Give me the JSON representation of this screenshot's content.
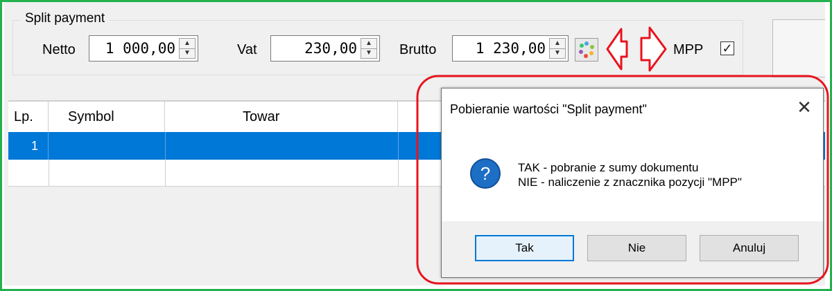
{
  "split_payment": {
    "title": "Split payment",
    "netto_label": "Netto",
    "netto_value": "1 000,00",
    "vat_label": "Vat",
    "vat_value": "230,00",
    "brutto_label": "Brutto",
    "brutto_value": "1 230,00",
    "mpp_label": "MPP",
    "mpp_checked": true
  },
  "grid": {
    "columns": [
      "Lp.",
      "Symbol",
      "Towar"
    ],
    "rows": [
      {
        "lp": "1"
      },
      {
        "lp": ""
      }
    ],
    "selected_row_color": "#0078d7"
  },
  "dialog": {
    "title": "Pobieranie wartości \"Split payment\"",
    "line1": "TAK - pobranie z sumy dokumentu",
    "line2": "NIE - naliczenie z znacznika pozycji \"MPP\"",
    "icon": "question-icon",
    "buttons": {
      "yes": "Tak",
      "no": "Nie",
      "cancel": "Anuluj"
    }
  },
  "annotations": {
    "frame_color": "#22b14c",
    "highlight_color": "#e8141e"
  }
}
